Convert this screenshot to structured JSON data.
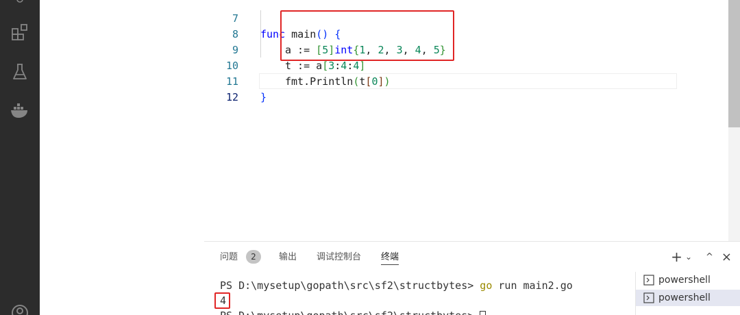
{
  "editor": {
    "lines": [
      {
        "num": "7",
        "text": "func main() {"
      },
      {
        "num": "8",
        "text": "a := [5]int{1, 2, 3, 4, 5}"
      },
      {
        "num": "9",
        "text": "t := a[3:4:4]"
      },
      {
        "num": "10",
        "text": "fmt.Println(t[0])"
      },
      {
        "num": "11",
        "text": "}"
      },
      {
        "num": "12",
        "text": ""
      }
    ]
  },
  "panel": {
    "tabs": [
      {
        "label": "问题",
        "badge": "2"
      },
      {
        "label": "输出"
      },
      {
        "label": "调试控制台"
      },
      {
        "label": "终端"
      }
    ],
    "actions": {
      "add": "+",
      "chevron": "⌄",
      "maximize": "^",
      "close": "×"
    }
  },
  "terminal": {
    "lines": [
      {
        "prompt": "PS D:\\mysetup\\gopath\\src\\sf2\\structbytes> ",
        "command": "go",
        "args": " run main2.go"
      },
      {
        "output": "4"
      },
      {
        "prompt": "PS D:\\mysetup\\gopath\\src\\sf2\\structbytes> "
      }
    ],
    "instances": [
      {
        "name": "powershell",
        "selected": false
      },
      {
        "name": "powershell",
        "selected": true
      }
    ]
  }
}
